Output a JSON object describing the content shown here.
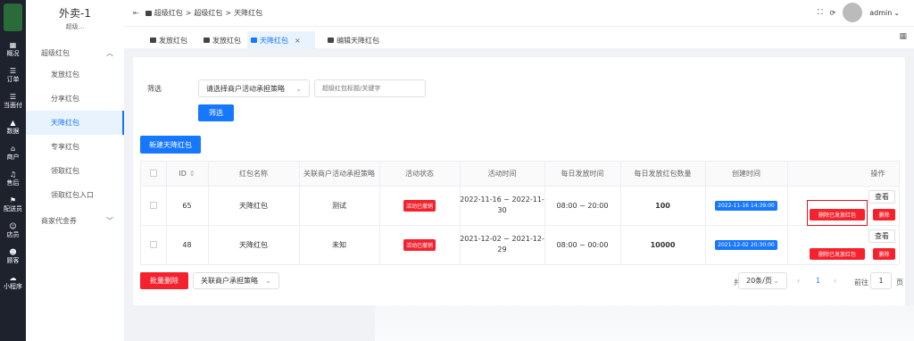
{
  "rail": {
    "items": [
      {
        "icon": "grid-icon",
        "glyph": "▦",
        "label": "概况"
      },
      {
        "icon": "list-icon",
        "glyph": "☰",
        "label": "订单"
      },
      {
        "icon": "list-icon",
        "glyph": "☰",
        "label": "当面付"
      },
      {
        "icon": "chart-icon",
        "glyph": "▲",
        "label": "数据"
      },
      {
        "icon": "store-icon",
        "glyph": "⌂",
        "label": "商户"
      },
      {
        "icon": "headset-icon",
        "glyph": "♫",
        "label": "售后"
      },
      {
        "icon": "rider-icon",
        "glyph": "⚑",
        "label": "配送员"
      },
      {
        "icon": "user-icon",
        "glyph": "☺",
        "label": "店员"
      },
      {
        "icon": "customer-icon",
        "glyph": "☻",
        "label": "顾客"
      },
      {
        "icon": "miniapp-icon",
        "glyph": "☁",
        "label": "小程序"
      }
    ]
  },
  "sidebar": {
    "store_name": "外卖-1",
    "store_sub": "超级...",
    "group_label": "超级红包",
    "items": [
      "发放红包",
      "分享红包",
      "天降红包",
      "专享红包",
      "领取红包",
      "领取红包入口"
    ],
    "group2_label": "商家代金券"
  },
  "header": {
    "crumbs": [
      "超级红包",
      "超级红包",
      "天降红包"
    ],
    "user": "admin"
  },
  "tabs": [
    "发放红包",
    "发放红包",
    "天降红包",
    "编辑天降红包"
  ],
  "filter": {
    "label": "筛选",
    "strategy_placeholder": "请选择商户活动承担策略",
    "keyword_placeholder": "超级红包标题/关键字",
    "button": "筛选"
  },
  "new_button": "新建天降红包",
  "table": {
    "headers": [
      "ID",
      "红包名称",
      "关联商户活动承担策略",
      "活动状态",
      "活动时间",
      "每日发放时间",
      "每日发放红包数量",
      "创建时间",
      "操作"
    ],
    "rows": [
      {
        "id": "65",
        "name": "天降红包",
        "strategy": "测试",
        "status": "活动已撤销",
        "period1": "2022-11-16 ~ 2022-11-",
        "period2": "30",
        "daily_time": "08:00 ~ 20:00",
        "count": "100",
        "created": "2022-11-16 14:39:00",
        "act_view": "查看",
        "act_stop": "删除已发放红包",
        "act_delete": "删除"
      },
      {
        "id": "48",
        "name": "天降红包",
        "strategy": "未知",
        "status": "活动已撤销",
        "period1": "2021-12-02 ~ 2021-12-",
        "period2": "29",
        "daily_time": "08:00 ~ 00:00",
        "count": "10000",
        "created": "2021-12-02 20:30:00",
        "act_view": "查看",
        "act_stop": "删除已发放红包",
        "act_delete": "删除"
      }
    ]
  },
  "footer": {
    "batch_delete": "批量删除",
    "strategy_select": "关联商户承担策略",
    "total": "共 2 条",
    "page_size": "20条/页",
    "current_page": "1",
    "goto_label": "前往",
    "goto_value": "1",
    "page_unit": "页"
  },
  "colors": {
    "accent": "#1677ff",
    "danger": "#f5222d",
    "rail": "#1e222d"
  }
}
